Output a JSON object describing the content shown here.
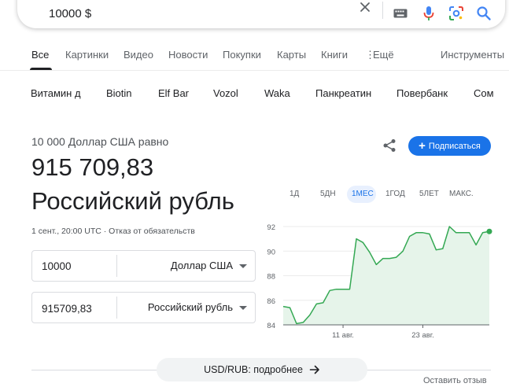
{
  "search": {
    "query": "10000 $"
  },
  "tabs": [
    {
      "label": "Все",
      "active": true
    },
    {
      "label": "Картинки"
    },
    {
      "label": "Видео"
    },
    {
      "label": "Новости"
    },
    {
      "label": "Покупки"
    },
    {
      "label": "Карты"
    },
    {
      "label": "Книги"
    },
    {
      "label": "Ещё"
    }
  ],
  "tools_label": "Инструменты",
  "chips": [
    "Витамин д",
    "Biotin",
    "Elf Bar",
    "Vozol",
    "Waka",
    "Панкреатин",
    "Повербанк",
    "Сом"
  ],
  "converter": {
    "from_label": "10 000 Доллар США равно",
    "result_value": "915 709,83",
    "result_currency": "Российский рубль",
    "meta": "1 сент., 20:00 UTC · Отказ от обязательств",
    "subscribe_label": "Подписаться",
    "amount_from": "10000",
    "currency_from": "Доллар США",
    "amount_to": "915709,83",
    "currency_to": "Российский рубль"
  },
  "ranges": [
    {
      "label": "1Д"
    },
    {
      "label": "5ДН"
    },
    {
      "label": "1МЕС",
      "active": true
    },
    {
      "label": "1ГОД"
    },
    {
      "label": "5ЛЕТ"
    },
    {
      "label": "МАКС."
    }
  ],
  "chart_data": {
    "type": "area",
    "y_ticks": [
      "92",
      "90",
      "88",
      "86",
      "84"
    ],
    "x_ticks": [
      "11 авг.",
      "23 авг."
    ],
    "ylim": [
      84,
      92
    ],
    "values": [
      85.5,
      85.4,
      84.1,
      84.2,
      84.8,
      85.7,
      85.8,
      86.8,
      86.9,
      86.9,
      86.9,
      91.0,
      90.7,
      89.9,
      88.9,
      89.4,
      89.4,
      89.5,
      90.0,
      91.2,
      91.5,
      91.5,
      91.4,
      90.1,
      90.2,
      92.0,
      91.5,
      91.5,
      91.5,
      90.5,
      91.5,
      91.6
    ],
    "line_color": "#34a853",
    "fill_color": "#e6f4ea",
    "grid": true
  },
  "footer": {
    "more_label": "USD/RUB: подробнее",
    "feedback_label": "Оставить отзыв"
  },
  "colors": {
    "accent": "#1a73e8",
    "positive": "#34a853"
  }
}
